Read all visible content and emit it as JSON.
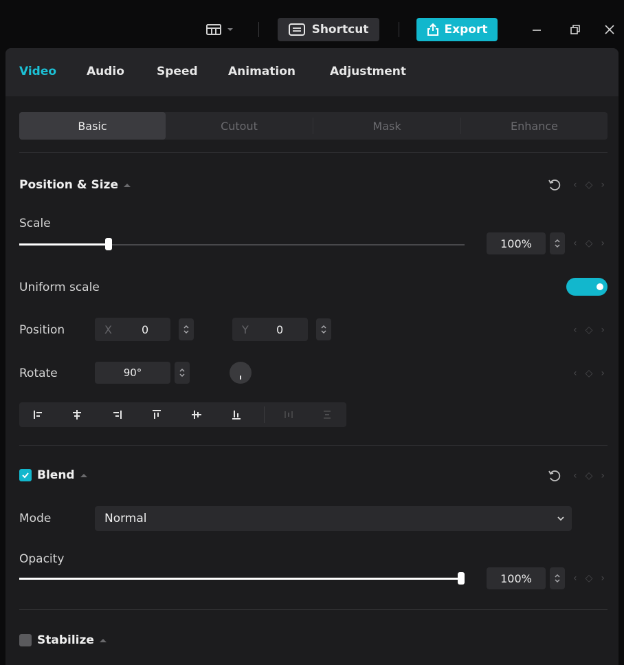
{
  "titlebar": {
    "shortcut_label": "Shortcut",
    "export_label": "Export",
    "accent": "#12b7cd"
  },
  "tabs": [
    {
      "label": "Video",
      "active": true
    },
    {
      "label": "Audio",
      "active": false
    },
    {
      "label": "Speed",
      "active": false
    },
    {
      "label": "Animation",
      "active": false
    },
    {
      "label": "Adjustment",
      "active": false
    }
  ],
  "subtabs": [
    {
      "label": "Basic",
      "active": true
    },
    {
      "label": "Cutout",
      "active": false
    },
    {
      "label": "Mask",
      "active": false
    },
    {
      "label": "Enhance",
      "active": false
    }
  ],
  "position_size": {
    "title": "Position & Size",
    "scale_label": "Scale",
    "scale_value": "100%",
    "scale_fraction": 0.2,
    "uniform_scale_label": "Uniform scale",
    "uniform_scale_on": true,
    "position_label": "Position",
    "x_prefix": "X",
    "x_value": "0",
    "y_prefix": "Y",
    "y_value": "0",
    "rotate_label": "Rotate",
    "rotate_value": "90°",
    "align_icons": [
      "align-left-icon",
      "align-center-horizontal-icon",
      "align-right-icon",
      "align-top-icon",
      "align-center-vertical-icon",
      "align-bottom-icon",
      "distribute-horizontal-icon",
      "distribute-vertical-icon"
    ]
  },
  "blend": {
    "title": "Blend",
    "enabled": true,
    "mode_label": "Mode",
    "mode_value": "Normal",
    "opacity_label": "Opacity",
    "opacity_value": "100%",
    "opacity_fraction": 1.0
  },
  "stabilize": {
    "title": "Stabilize",
    "enabled": false
  }
}
